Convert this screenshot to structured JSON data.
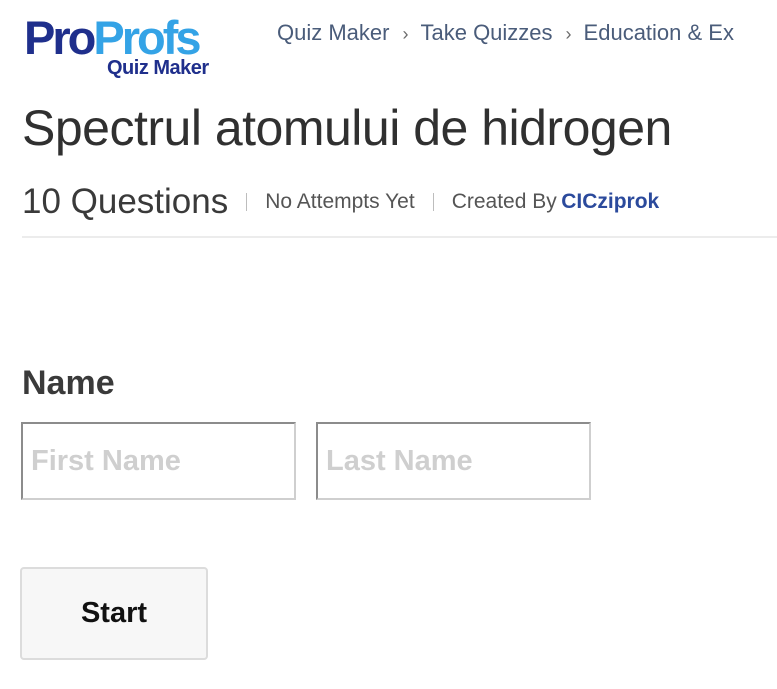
{
  "logo": {
    "pro": "Pro",
    "profs": "Profs",
    "subtitle": "Quiz Maker"
  },
  "breadcrumb": [
    "Quiz Maker",
    "Take Quizzes",
    "Education & Ex"
  ],
  "breadcrumb_separator": "›",
  "quiz": {
    "title": "Spectrul atomului de hidrogen",
    "question_count": "10 Questions",
    "attempts": "No Attempts Yet",
    "created_by_label": "Created By",
    "author": "CICziprok"
  },
  "form": {
    "name_label": "Name",
    "first_name_placeholder": "First Name",
    "last_name_placeholder": "Last Name",
    "first_name_value": "",
    "last_name_value": "",
    "start_label": "Start"
  },
  "colors": {
    "brand_dark": "#1f2f8c",
    "brand_light": "#34a3e6",
    "link": "#2b4a9c"
  }
}
